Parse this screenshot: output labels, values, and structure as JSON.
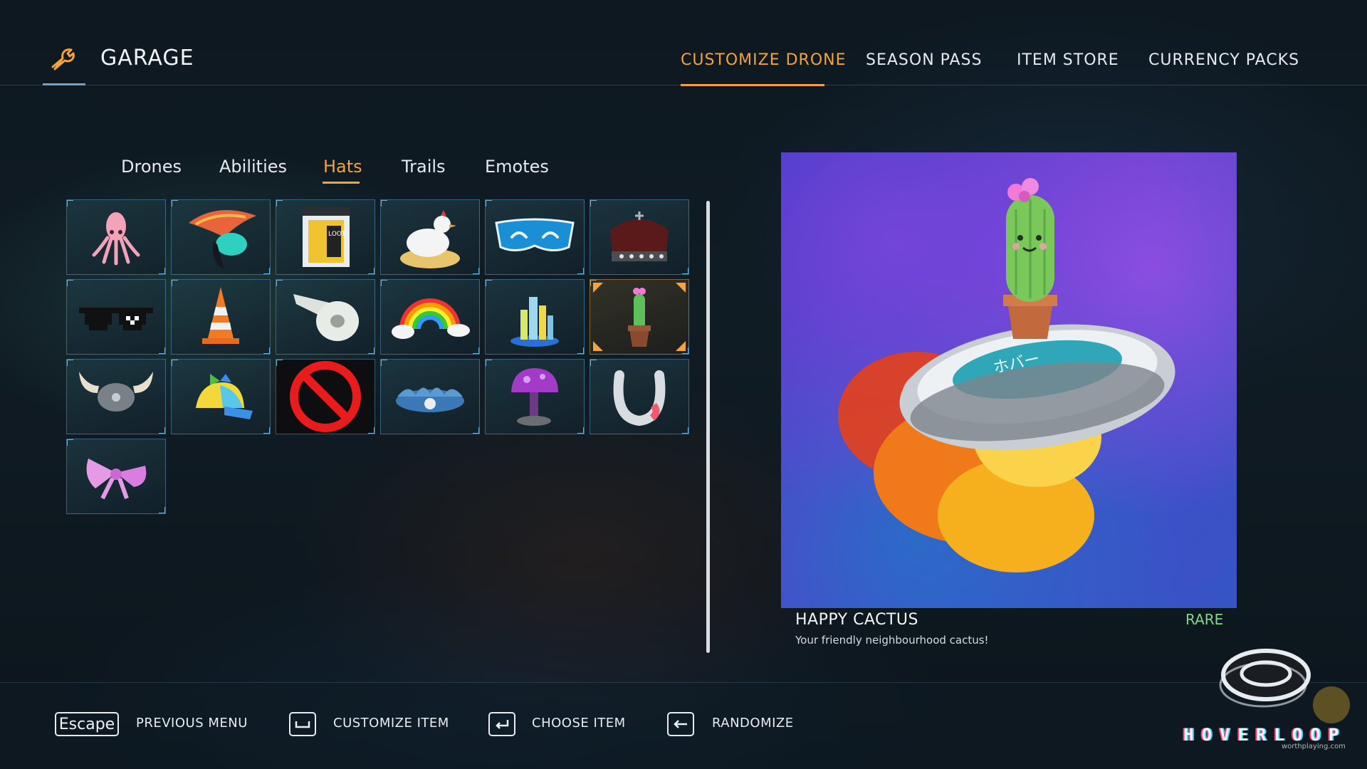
{
  "header": {
    "title": "GARAGE",
    "icon": "wrench-icon",
    "tabs": [
      {
        "label": "CUSTOMIZE DRONE",
        "active": true
      },
      {
        "label": "SEASON PASS",
        "active": false
      },
      {
        "label": "ITEM STORE",
        "active": false
      },
      {
        "label": "CURRENCY PACKS",
        "active": false
      }
    ]
  },
  "subtabs": [
    {
      "label": "Drones",
      "active": false
    },
    {
      "label": "Abilities",
      "active": false
    },
    {
      "label": "Hats",
      "active": true
    },
    {
      "label": "Trails",
      "active": false
    },
    {
      "label": "Emotes",
      "active": false
    }
  ],
  "hats": [
    {
      "icon": "squid-icon"
    },
    {
      "icon": "mohawk-helmet-icon"
    },
    {
      "icon": "loot-box-icon"
    },
    {
      "icon": "chicken-nest-icon"
    },
    {
      "icon": "visor-icon"
    },
    {
      "icon": "crown-icon"
    },
    {
      "icon": "pixel-sunglasses-icon"
    },
    {
      "icon": "traffic-cone-icon"
    },
    {
      "icon": "toilet-paper-icon"
    },
    {
      "icon": "rainbow-icon"
    },
    {
      "icon": "city-skyline-icon"
    },
    {
      "icon": "cactus-pot-icon",
      "selected": true
    },
    {
      "icon": "viking-horns-icon"
    },
    {
      "icon": "propeller-cap-icon"
    },
    {
      "icon": "none-icon"
    },
    {
      "icon": "shell-crown-icon"
    },
    {
      "icon": "mushroom-icon"
    },
    {
      "icon": "horseshoe-icon"
    },
    {
      "icon": "pink-bow-icon"
    }
  ],
  "preview": {
    "name": "HAPPY CACTUS",
    "rarity": "RARE",
    "description": "Your friendly neighbourhood cactus!",
    "drone_label": "ホバー"
  },
  "footer": {
    "actions": [
      {
        "key": "Escape",
        "label": "PREVIOUS MENU"
      },
      {
        "key": "space-key-icon",
        "label": "CUSTOMIZE ITEM"
      },
      {
        "key": "enter-key-icon",
        "label": "CHOOSE ITEM"
      },
      {
        "key": "backspace-key-icon",
        "label": "RANDOMIZE"
      }
    ]
  },
  "branding": {
    "logo": "HOVERLOOP",
    "watermark": "worthplaying.com"
  },
  "colors": {
    "accent": "#f3a33b",
    "rare": "#7fd68a",
    "cell_border": "#5fb3e6"
  }
}
